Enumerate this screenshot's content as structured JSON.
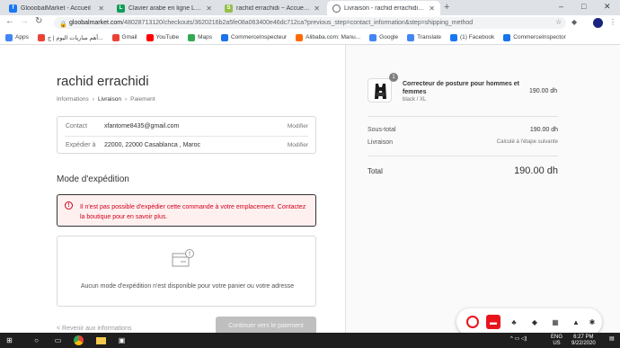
{
  "browser": {
    "tabs": [
      {
        "title": "GlooobalMarket - Accueil",
        "favicon_color": "#1877f2",
        "favicon_letter": "f"
      },
      {
        "title": "Clavier arabe en ligne LEXILOGOS",
        "favicon_color": "#0f9d58",
        "favicon_letter": "L"
      },
      {
        "title": "rachid errachidi ~ Accueil ~ Shopify",
        "favicon_color": "#95bf47",
        "favicon_letter": "S"
      },
      {
        "title": "Livraison - rachid errachidi - Paiement",
        "favicon_color": "#5f6368",
        "favicon_letter": ""
      }
    ],
    "new_tab": "+",
    "url_domain": "gloobalmarket.com",
    "url_path": "/48028713120/checkouts/3620216b2a5fe08a063400e46dc712ca?previous_step=contact_information&step=shipping_method",
    "bookmarks": [
      {
        "label": "Apps",
        "color": "#4285f4"
      },
      {
        "label": "أهم مباريات اليوم | ج...",
        "color": "#ea4335"
      },
      {
        "label": "Gmail",
        "color": "#ea4335"
      },
      {
        "label": "YouTube",
        "color": "#ff0000"
      },
      {
        "label": "Maps",
        "color": "#34a853"
      },
      {
        "label": "CommerceInspecteur",
        "color": "#1a73e8"
      },
      {
        "label": "Alibaba.com: Manu...",
        "color": "#ff6a00"
      },
      {
        "label": "Google",
        "color": "#4285f4"
      },
      {
        "label": "Translate",
        "color": "#4285f4"
      },
      {
        "label": "(1) Facebook",
        "color": "#1877f2"
      },
      {
        "label": "CommerceInspector",
        "color": "#1a73e8"
      }
    ]
  },
  "checkout": {
    "shop_name": "rachid errachidi",
    "breadcrumb": [
      "Informations",
      "Livraison",
      "Paiement"
    ],
    "breadcrumb_sep": "›",
    "review": [
      {
        "label": "Contact",
        "value": "xfantome8435@gmail.com",
        "action": "Modifier"
      },
      {
        "label": "Expédier à",
        "value": "22000, 22000 Casablanca , Maroc",
        "action": "Modifier"
      }
    ],
    "section_title": "Mode d'expédition",
    "error_message": "Il n'est pas possible d'expédier cette commande à votre emplacement. Contactez la boutique pour en savoir plus.",
    "no_shipping_message": "Aucun mode d'expédition n'est disponible pour votre panier ou votre adresse",
    "return_link": "< Revenir aux informations",
    "continue_button": "Continuer vers le paiement"
  },
  "summary": {
    "product_name": "Correcteur de posture pour hommes et femmes",
    "product_variant": "black / XL",
    "product_qty": "1",
    "product_price": "190.00 dh",
    "subtotal_label": "Sous-total",
    "subtotal_value": "190.00 dh",
    "shipping_label": "Livraison",
    "shipping_value": "Calculé à l'étape suivante",
    "total_label": "Total",
    "total_value": "190.00 dh"
  },
  "taskbar": {
    "lang": "ENG",
    "region": "US",
    "time": "6:27 PM",
    "date": "9/22/2020"
  },
  "colors": {
    "error": "#d0021b",
    "widget_accent": "#e8141c"
  }
}
